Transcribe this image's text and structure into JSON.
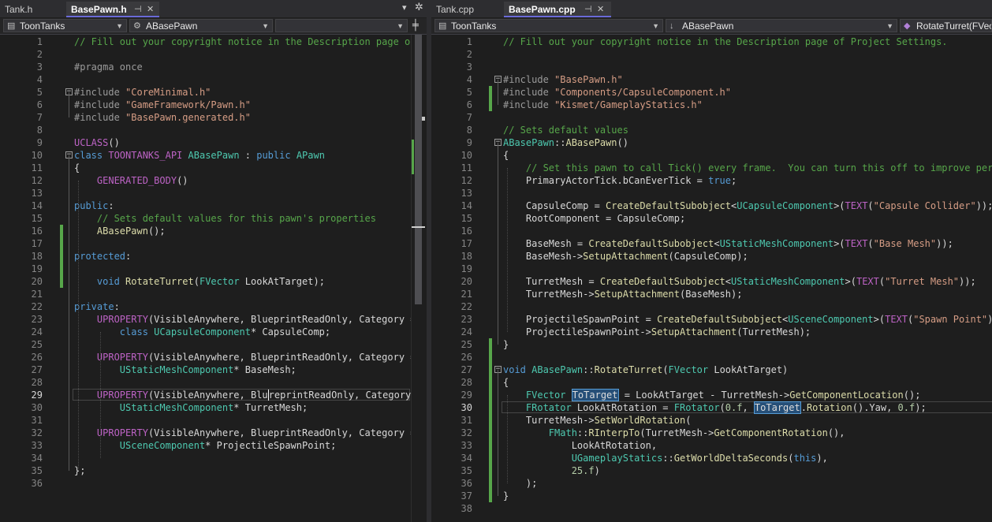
{
  "left": {
    "tabs": [
      {
        "label": "Tank.h",
        "active": false
      },
      {
        "label": "BasePawn.h",
        "active": true,
        "pin": "⊣",
        "close": "✕"
      }
    ],
    "tab_overflow": "▾",
    "settings_icon": "gear-icon",
    "nav": {
      "project": "ToonTanks",
      "scope": "ABasePawn",
      "member": ""
    },
    "current_line": 29,
    "lines": [
      {
        "n": 1,
        "t": [
          [
            "c",
            "// Fill out your copyright notice in the Description page of"
          ]
        ]
      },
      {
        "n": 2,
        "t": []
      },
      {
        "n": 3,
        "t": [
          [
            "p",
            "#pragma once"
          ]
        ]
      },
      {
        "n": 4,
        "t": []
      },
      {
        "n": 5,
        "fold": "-",
        "t": [
          [
            "p",
            "#include "
          ],
          [
            "s",
            "\"CoreMinimal.h\""
          ]
        ]
      },
      {
        "n": 6,
        "t": [
          [
            "p",
            "#include "
          ],
          [
            "s",
            "\"GameFramework/Pawn.h\""
          ]
        ]
      },
      {
        "n": 7,
        "t": [
          [
            "p",
            "#include "
          ],
          [
            "s",
            "\"BasePawn.generated.h\""
          ]
        ]
      },
      {
        "n": 8,
        "t": []
      },
      {
        "n": 9,
        "t": [
          [
            "m",
            "UCLASS"
          ],
          [
            "pu",
            "()"
          ]
        ]
      },
      {
        "n": 10,
        "fold": "-",
        "t": [
          [
            "k",
            "class "
          ],
          [
            "m",
            "TOONTANKS_API "
          ],
          [
            "t",
            "ABasePawn"
          ],
          [
            "pu",
            " : "
          ],
          [
            "k",
            "public "
          ],
          [
            "t",
            "APawn"
          ]
        ]
      },
      {
        "n": 11,
        "t": [
          [
            "pu",
            "{"
          ]
        ]
      },
      {
        "n": 12,
        "t": [
          [
            "pu",
            "    "
          ],
          [
            "m",
            "GENERATED_BODY"
          ],
          [
            "pu",
            "()"
          ]
        ]
      },
      {
        "n": 13,
        "t": []
      },
      {
        "n": 14,
        "t": [
          [
            "k",
            "public"
          ],
          [
            "pu",
            ":"
          ]
        ]
      },
      {
        "n": 15,
        "t": [
          [
            "pu",
            "    "
          ],
          [
            "c",
            "// Sets default values for this pawn's properties"
          ]
        ]
      },
      {
        "n": 16,
        "chg": true,
        "t": [
          [
            "pu",
            "    "
          ],
          [
            "f",
            "ABasePawn"
          ],
          [
            "pu",
            "();"
          ]
        ]
      },
      {
        "n": 17,
        "chg": true,
        "t": []
      },
      {
        "n": 18,
        "chg": true,
        "t": [
          [
            "k",
            "protected"
          ],
          [
            "pu",
            ":"
          ]
        ]
      },
      {
        "n": 19,
        "chg": true,
        "t": []
      },
      {
        "n": 20,
        "chg": true,
        "t": [
          [
            "pu",
            "    "
          ],
          [
            "k",
            "void "
          ],
          [
            "f",
            "RotateTurret"
          ],
          [
            "pu",
            "("
          ],
          [
            "t",
            "FVector"
          ],
          [
            "pu",
            " LookAtTarget);"
          ]
        ]
      },
      {
        "n": 21,
        "t": []
      },
      {
        "n": 22,
        "t": [
          [
            "k",
            "private"
          ],
          [
            "pu",
            ":"
          ]
        ]
      },
      {
        "n": 23,
        "t": [
          [
            "pu",
            "    "
          ],
          [
            "m",
            "UPROPERTY"
          ],
          [
            "pu",
            "(VisibleAnywhere, BlueprintReadOnly, Category ="
          ]
        ]
      },
      {
        "n": 24,
        "t": [
          [
            "pu",
            "        "
          ],
          [
            "k",
            "class "
          ],
          [
            "t",
            "UCapsuleComponent"
          ],
          [
            "pu",
            "* CapsuleComp;"
          ]
        ]
      },
      {
        "n": 25,
        "t": []
      },
      {
        "n": 26,
        "t": [
          [
            "pu",
            "    "
          ],
          [
            "m",
            "UPROPERTY"
          ],
          [
            "pu",
            "(VisibleAnywhere, BlueprintReadOnly, Category ="
          ]
        ]
      },
      {
        "n": 27,
        "t": [
          [
            "pu",
            "        "
          ],
          [
            "t",
            "UStaticMeshComponent"
          ],
          [
            "pu",
            "* BaseMesh;"
          ]
        ]
      },
      {
        "n": 28,
        "t": []
      },
      {
        "n": 29,
        "t": [
          [
            "pu",
            "    "
          ],
          [
            "m",
            "UPROPERTY"
          ],
          [
            "pu",
            "(VisibleAnywhere, Blu"
          ],
          [
            "caret",
            ""
          ],
          [
            "pu",
            "eprintReadOnly, Category ="
          ]
        ],
        "caret_fix": "r"
      },
      {
        "n": 30,
        "t": [
          [
            "pu",
            "        "
          ],
          [
            "t",
            "UStaticMeshComponent"
          ],
          [
            "pu",
            "* TurretMesh;"
          ]
        ]
      },
      {
        "n": 31,
        "t": []
      },
      {
        "n": 32,
        "t": [
          [
            "pu",
            "    "
          ],
          [
            "m",
            "UPROPERTY"
          ],
          [
            "pu",
            "(VisibleAnywhere, BlueprintReadOnly, Category ="
          ]
        ]
      },
      {
        "n": 33,
        "t": [
          [
            "pu",
            "        "
          ],
          [
            "t",
            "USceneComponent"
          ],
          [
            "pu",
            "* ProjectileSpawnPoint;"
          ]
        ]
      },
      {
        "n": 34,
        "t": []
      },
      {
        "n": 35,
        "t": [
          [
            "pu",
            "};"
          ]
        ]
      },
      {
        "n": 36,
        "t": []
      }
    ]
  },
  "right": {
    "tabs": [
      {
        "label": "Tank.cpp",
        "active": false
      },
      {
        "label": "BasePawn.cpp",
        "active": true,
        "pin": "⊣",
        "close": "✕"
      }
    ],
    "nav": {
      "project": "ToonTanks",
      "scope": "ABasePawn",
      "member": "RotateTurret(FVect"
    },
    "current_line": 30,
    "lines": [
      {
        "n": 1,
        "t": [
          [
            "c",
            "// Fill out your copyright notice in the Description page of Project Settings."
          ]
        ]
      },
      {
        "n": 2,
        "t": []
      },
      {
        "n": 3,
        "t": []
      },
      {
        "n": 4,
        "fold": "-",
        "t": [
          [
            "p",
            "#include "
          ],
          [
            "s",
            "\"BasePawn.h\""
          ]
        ]
      },
      {
        "n": 5,
        "chg": true,
        "t": [
          [
            "p",
            "#include "
          ],
          [
            "s",
            "\"Components/CapsuleComponent.h\""
          ]
        ]
      },
      {
        "n": 6,
        "chg": true,
        "t": [
          [
            "p",
            "#include "
          ],
          [
            "s",
            "\"Kismet/GameplayStatics.h\""
          ]
        ]
      },
      {
        "n": 7,
        "t": []
      },
      {
        "n": 8,
        "t": [
          [
            "c",
            "// Sets default values"
          ]
        ]
      },
      {
        "n": 9,
        "fold": "-",
        "t": [
          [
            "t",
            "ABasePawn"
          ],
          [
            "pu",
            "::"
          ],
          [
            "f",
            "ABasePawn"
          ],
          [
            "pu",
            "()"
          ]
        ]
      },
      {
        "n": 10,
        "t": [
          [
            "pu",
            "{"
          ]
        ]
      },
      {
        "n": 11,
        "t": [
          [
            "pu",
            "    "
          ],
          [
            "c",
            "// Set this pawn to call Tick() every frame.  You can turn this off to improve perfor"
          ]
        ]
      },
      {
        "n": 12,
        "t": [
          [
            "pu",
            "    PrimaryActorTick.bCanEverTick = "
          ],
          [
            "k",
            "true"
          ],
          [
            "pu",
            ";"
          ]
        ]
      },
      {
        "n": 13,
        "t": []
      },
      {
        "n": 14,
        "t": [
          [
            "pu",
            "    CapsuleComp = "
          ],
          [
            "f",
            "CreateDefaultSubobject"
          ],
          [
            "pu",
            "<"
          ],
          [
            "t",
            "UCapsuleComponent"
          ],
          [
            "pu",
            ">("
          ],
          [
            "m",
            "TEXT"
          ],
          [
            "pu",
            "("
          ],
          [
            "s",
            "\"Capsule Collider\""
          ],
          [
            "pu",
            "));"
          ]
        ]
      },
      {
        "n": 15,
        "t": [
          [
            "pu",
            "    RootComponent = CapsuleComp;"
          ]
        ]
      },
      {
        "n": 16,
        "t": []
      },
      {
        "n": 17,
        "t": [
          [
            "pu",
            "    BaseMesh = "
          ],
          [
            "f",
            "CreateDefaultSubobject"
          ],
          [
            "pu",
            "<"
          ],
          [
            "t",
            "UStaticMeshComponent"
          ],
          [
            "pu",
            ">("
          ],
          [
            "m",
            "TEXT"
          ],
          [
            "pu",
            "("
          ],
          [
            "s",
            "\"Base Mesh\""
          ],
          [
            "pu",
            "));"
          ]
        ]
      },
      {
        "n": 18,
        "t": [
          [
            "pu",
            "    BaseMesh->"
          ],
          [
            "f",
            "SetupAttachment"
          ],
          [
            "pu",
            "(CapsuleComp);"
          ]
        ]
      },
      {
        "n": 19,
        "t": []
      },
      {
        "n": 20,
        "t": [
          [
            "pu",
            "    TurretMesh = "
          ],
          [
            "f",
            "CreateDefaultSubobject"
          ],
          [
            "pu",
            "<"
          ],
          [
            "t",
            "UStaticMeshComponent"
          ],
          [
            "pu",
            ">("
          ],
          [
            "m",
            "TEXT"
          ],
          [
            "pu",
            "("
          ],
          [
            "s",
            "\"Turret Mesh\""
          ],
          [
            "pu",
            "));"
          ]
        ]
      },
      {
        "n": 21,
        "t": [
          [
            "pu",
            "    TurretMesh->"
          ],
          [
            "f",
            "SetupAttachment"
          ],
          [
            "pu",
            "(BaseMesh);"
          ]
        ]
      },
      {
        "n": 22,
        "t": []
      },
      {
        "n": 23,
        "t": [
          [
            "pu",
            "    ProjectileSpawnPoint = "
          ],
          [
            "f",
            "CreateDefaultSubobject"
          ],
          [
            "pu",
            "<"
          ],
          [
            "t",
            "USceneComponent"
          ],
          [
            "pu",
            ">("
          ],
          [
            "m",
            "TEXT"
          ],
          [
            "pu",
            "("
          ],
          [
            "s",
            "\"Spawn Point\""
          ],
          [
            "pu",
            "));"
          ]
        ]
      },
      {
        "n": 24,
        "t": [
          [
            "pu",
            "    ProjectileSpawnPoint->"
          ],
          [
            "f",
            "SetupAttachment"
          ],
          [
            "pu",
            "(TurretMesh);"
          ]
        ]
      },
      {
        "n": 25,
        "chg": true,
        "t": [
          [
            "pu",
            "}"
          ]
        ]
      },
      {
        "n": 26,
        "chg": true,
        "t": []
      },
      {
        "n": 27,
        "chg": true,
        "fold": "-",
        "t": [
          [
            "k",
            "void "
          ],
          [
            "t",
            "ABasePawn"
          ],
          [
            "pu",
            "::"
          ],
          [
            "f",
            "RotateTurret"
          ],
          [
            "pu",
            "("
          ],
          [
            "t",
            "FVector"
          ],
          [
            "pu",
            " LookAtTarget)"
          ]
        ]
      },
      {
        "n": 28,
        "chg": true,
        "t": [
          [
            "pu",
            "{"
          ]
        ]
      },
      {
        "n": 29,
        "chg": true,
        "t": [
          [
            "pu",
            "    "
          ],
          [
            "t",
            "FVector "
          ],
          [
            "hl",
            "ToTarget"
          ],
          [
            "pu",
            " = LookAtTarget - TurretMesh->"
          ],
          [
            "f",
            "GetComponentLocation"
          ],
          [
            "pu",
            "();"
          ]
        ]
      },
      {
        "n": 30,
        "chg": true,
        "t": [
          [
            "pu",
            "    "
          ],
          [
            "t",
            "FRotator"
          ],
          [
            "pu",
            " LookAtRotation = "
          ],
          [
            "t",
            "FRotator"
          ],
          [
            "pu",
            "("
          ],
          [
            "n",
            "0.f"
          ],
          [
            "pu",
            ", "
          ],
          [
            "hl",
            "ToTarget"
          ],
          [
            "pu",
            "."
          ],
          [
            "f",
            "Rotation"
          ],
          [
            "pu",
            "().Yaw, "
          ],
          [
            "n",
            "0.f"
          ],
          [
            "pu",
            ");"
          ]
        ]
      },
      {
        "n": 31,
        "chg": true,
        "t": [
          [
            "pu",
            "    TurretMesh->"
          ],
          [
            "f",
            "SetWorldRotation"
          ],
          [
            "pu",
            "("
          ]
        ]
      },
      {
        "n": 32,
        "chg": true,
        "t": [
          [
            "pu",
            "        "
          ],
          [
            "t",
            "FMath"
          ],
          [
            "pu",
            "::"
          ],
          [
            "f",
            "RInterpTo"
          ],
          [
            "pu",
            "(TurretMesh->"
          ],
          [
            "f",
            "GetComponentRotation"
          ],
          [
            "pu",
            "(),"
          ]
        ]
      },
      {
        "n": 33,
        "chg": true,
        "t": [
          [
            "pu",
            "            LookAtRotation,"
          ]
        ]
      },
      {
        "n": 34,
        "chg": true,
        "t": [
          [
            "pu",
            "            "
          ],
          [
            "t",
            "UGameplayStatics"
          ],
          [
            "pu",
            "::"
          ],
          [
            "f",
            "GetWorldDeltaSeconds"
          ],
          [
            "pu",
            "("
          ],
          [
            "k",
            "this"
          ],
          [
            "pu",
            "),"
          ]
        ]
      },
      {
        "n": 35,
        "chg": true,
        "t": [
          [
            "pu",
            "            "
          ],
          [
            "n",
            "25.f"
          ],
          [
            "pu",
            ")"
          ]
        ]
      },
      {
        "n": 36,
        "chg": true,
        "t": [
          [
            "pu",
            "    );"
          ]
        ]
      },
      {
        "n": 37,
        "chg": true,
        "t": [
          [
            "pu",
            "}"
          ]
        ]
      },
      {
        "n": 38,
        "t": []
      }
    ]
  }
}
